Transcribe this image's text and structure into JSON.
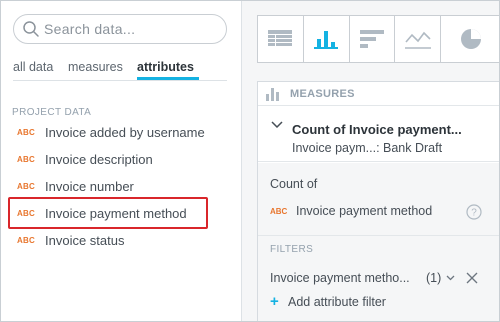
{
  "search": {
    "placeholder": "Search data..."
  },
  "tabs": [
    {
      "label": "all data"
    },
    {
      "label": "measures"
    },
    {
      "label": "attributes",
      "active": true
    }
  ],
  "catalog": {
    "section_title": "PROJECT DATA",
    "items": [
      {
        "badge": "ABC",
        "label": "Invoice added by username"
      },
      {
        "badge": "ABC",
        "label": "Invoice description"
      },
      {
        "badge": "ABC",
        "label": "Invoice number"
      },
      {
        "badge": "ABC",
        "label": "Invoice payment method",
        "highlighted": true
      },
      {
        "badge": "ABC",
        "label": "Invoice status"
      }
    ]
  },
  "viz_types": [
    "table-icon",
    "column-chart-icon",
    "bar-chart-icon",
    "line-chart-icon",
    "pie-chart-icon"
  ],
  "measures": {
    "title": "MEASURES",
    "item": {
      "name": "Count of Invoice payment...",
      "subtitle": "Invoice paym...: Bank Draft"
    },
    "config": {
      "count_of": "Count of",
      "attribute_badge": "ABC",
      "attribute": "Invoice payment method",
      "filters_title": "FILTERS",
      "filter_label": "Invoice payment metho...",
      "filter_count": "(1)",
      "add_filter": "Add attribute filter"
    }
  },
  "colors": {
    "accent": "#14b2e2",
    "badge": "#e8762e",
    "highlight": "#d9262b",
    "icon_gray": "#b0bac3"
  }
}
